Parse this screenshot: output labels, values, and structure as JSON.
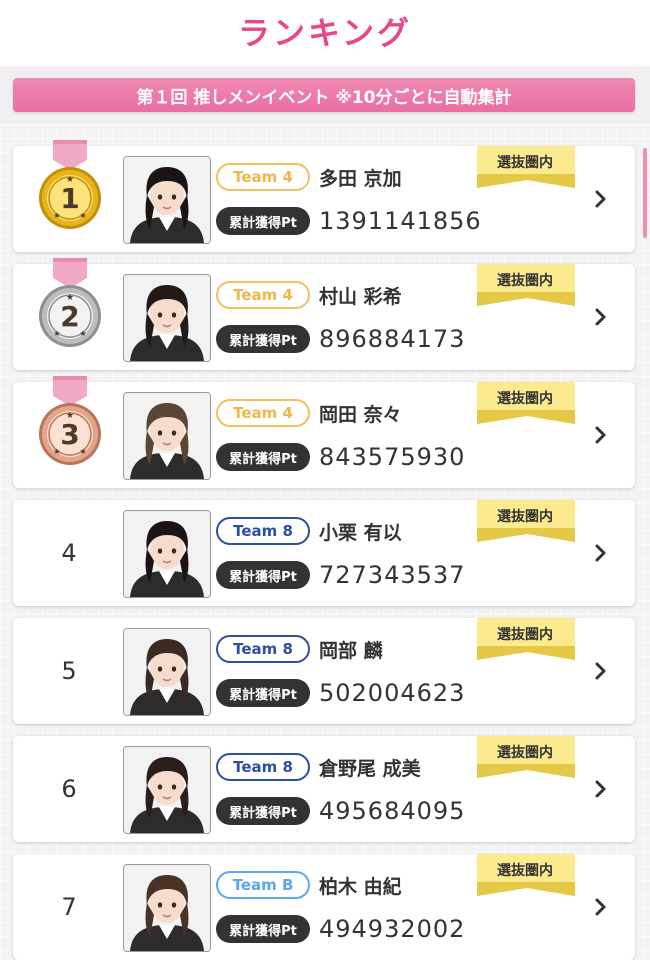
{
  "header": {
    "title": "ランキング"
  },
  "banner": {
    "text": "第１回 推しメンイベント ※10分ごとに自動集計"
  },
  "pt_label": "累計獲得Pt",
  "badge_label": "選抜圏内",
  "medal_colors": {
    "gold": "#f3c83a",
    "silver": "#bfbfbf",
    "bronze": "#e7a98f"
  },
  "entries": [
    {
      "rank": "1",
      "medal": "gold",
      "team": "Team 4",
      "team_color": "#f0b84a",
      "name": "多田 京加",
      "points": "1391141856"
    },
    {
      "rank": "2",
      "medal": "silver",
      "team": "Team 4",
      "team_color": "#f0b84a",
      "name": "村山 彩希",
      "points": "896884173"
    },
    {
      "rank": "3",
      "medal": "bronze",
      "team": "Team 4",
      "team_color": "#f0b84a",
      "name": "岡田 奈々",
      "points": "843575930"
    },
    {
      "rank": "4",
      "medal": "",
      "team": "Team 8",
      "team_color": "#2e4ea3",
      "name": "小栗 有以",
      "points": "727343537"
    },
    {
      "rank": "5",
      "medal": "",
      "team": "Team 8",
      "team_color": "#2e4ea3",
      "name": "岡部 麟",
      "points": "502004623"
    },
    {
      "rank": "6",
      "medal": "",
      "team": "Team 8",
      "team_color": "#2e4ea3",
      "name": "倉野尾 成美",
      "points": "495684095"
    },
    {
      "rank": "7",
      "medal": "",
      "team": "Team B",
      "team_color": "#5aa8e8",
      "name": "柏木 由紀",
      "points": "494932002"
    }
  ]
}
